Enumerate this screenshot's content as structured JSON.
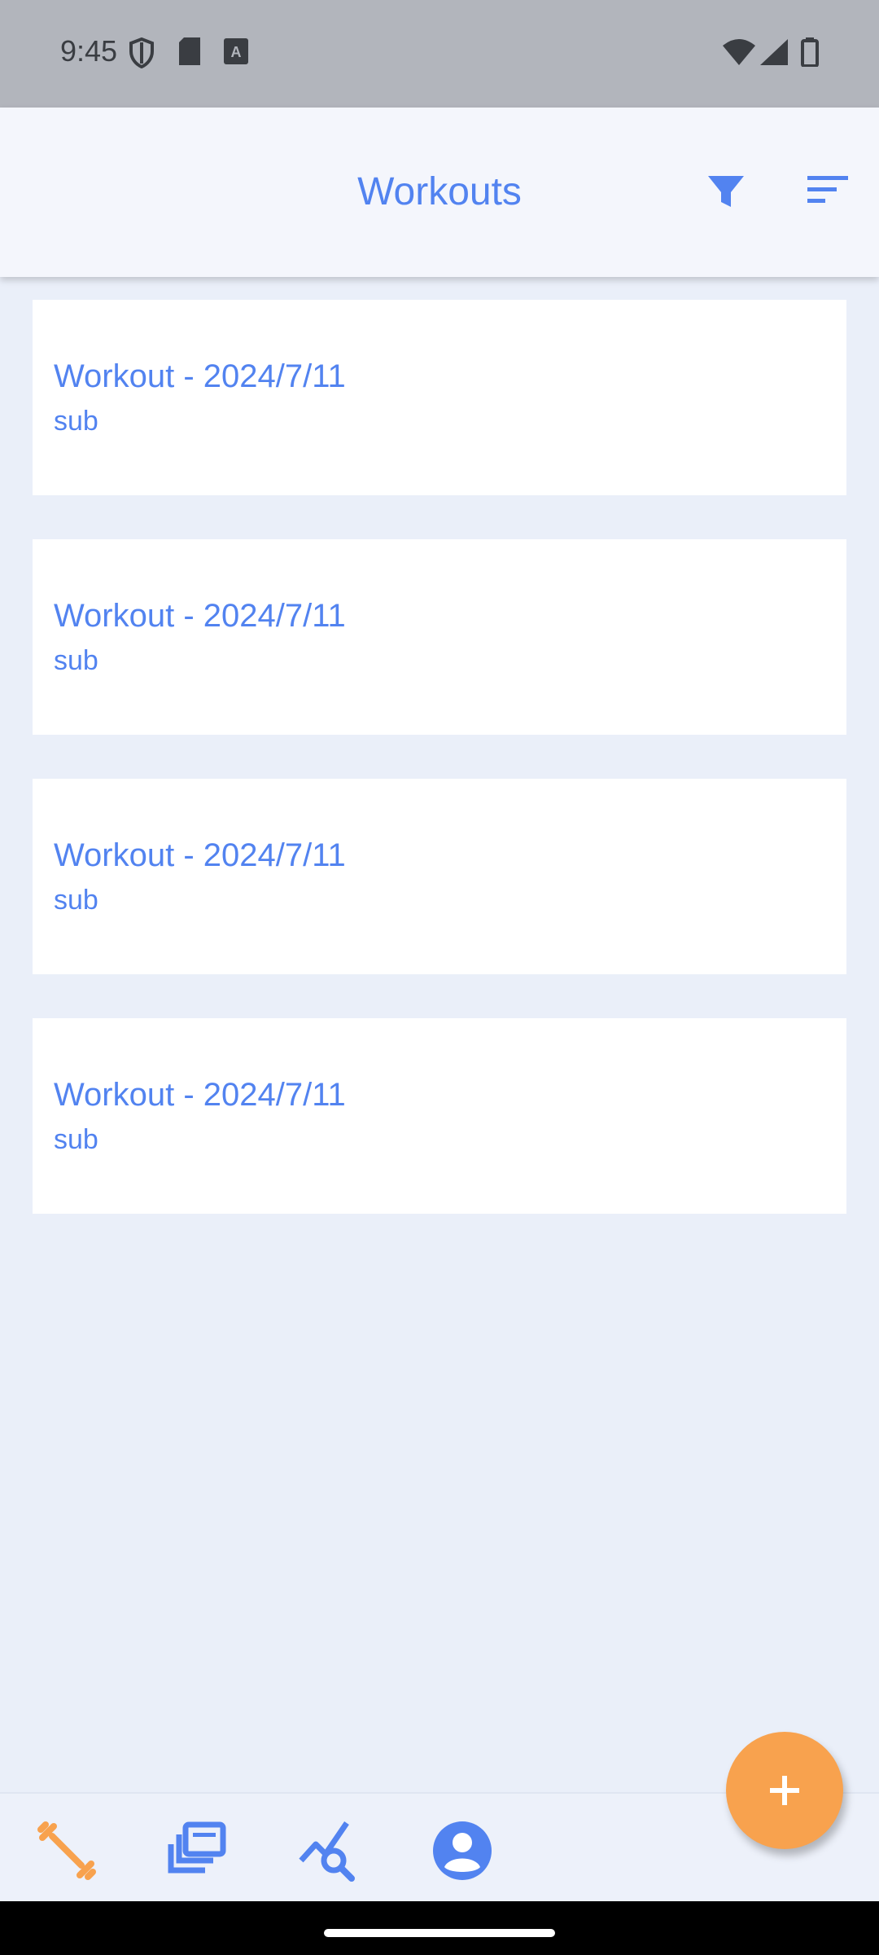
{
  "status_bar": {
    "time": "9:45",
    "icons": [
      "shield-icon",
      "sd-card-icon",
      "font-icon",
      "wifi-icon",
      "cell-signal-icon",
      "battery-icon"
    ]
  },
  "app_bar": {
    "title": "Workouts",
    "actions": [
      "filter-icon",
      "sort-icon"
    ]
  },
  "workouts": [
    {
      "title": "Workout - 2024/7/11",
      "subtitle": "sub"
    },
    {
      "title": "Workout - 2024/7/11",
      "subtitle": "sub"
    },
    {
      "title": "Workout - 2024/7/11",
      "subtitle": "sub"
    },
    {
      "title": "Workout - 2024/7/11",
      "subtitle": "sub"
    }
  ],
  "fab": {
    "icon": "plus-icon"
  },
  "bottom_nav": {
    "items": [
      "dumbbell-icon",
      "collections-icon",
      "analytics-icon",
      "account-icon"
    ],
    "active_index": 0
  },
  "colors": {
    "accent": "#5283f0",
    "orange": "#f8a24e",
    "background": "#eaeff9",
    "status_bar": "#b2b5bc"
  }
}
